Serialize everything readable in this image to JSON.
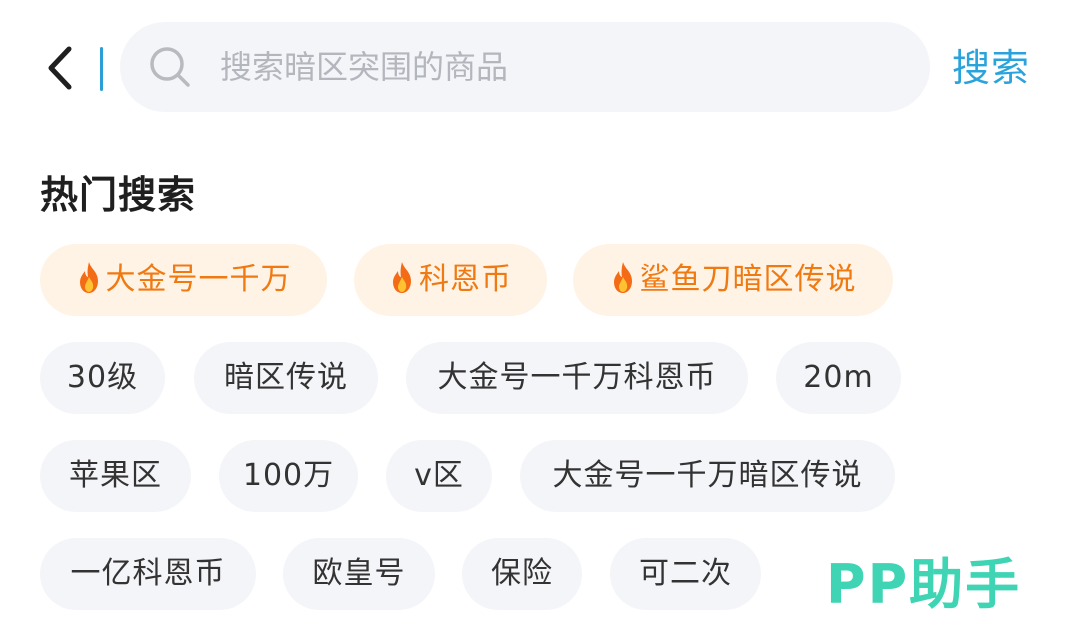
{
  "search": {
    "placeholder": "搜索暗区突围的商品",
    "value": "",
    "submit_label": "搜索"
  },
  "hot_section": {
    "title": "热门搜索",
    "hot_tags": [
      {
        "label": "大金号一千万"
      },
      {
        "label": "科恩币"
      },
      {
        "label": "鲨鱼刀暗区传说"
      }
    ],
    "rows": [
      [
        "30级",
        "暗区传说",
        "大金号一千万科恩币",
        "20m"
      ],
      [
        "苹果区",
        "100万",
        "v区",
        "大金号一千万暗区传说"
      ],
      [
        "一亿科恩币",
        "欧皇号",
        "保险",
        "可二次"
      ]
    ]
  },
  "watermark": {
    "text": "PP助手"
  },
  "colors": {
    "accent": "#2aa3dc",
    "hot_text": "#f07a12",
    "hot_bg": "#fff3e6",
    "tag_bg": "#f4f5f8",
    "watermark": "#3fd4b3"
  },
  "icons": {
    "back": "chevron-left-icon",
    "search": "search-icon",
    "hot": "fire-icon"
  }
}
